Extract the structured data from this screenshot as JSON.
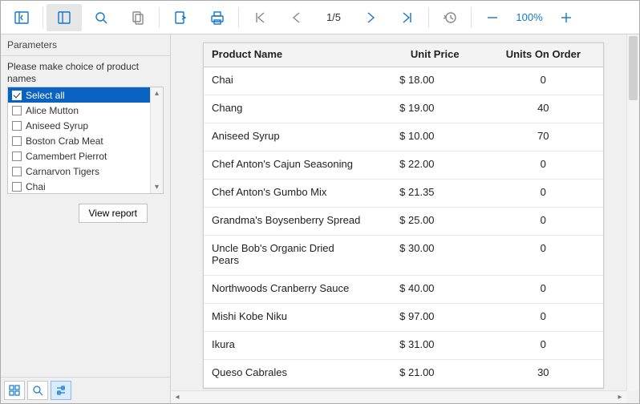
{
  "toolbar": {
    "page_indicator": "1/5",
    "zoom_label": "100%"
  },
  "sidebar": {
    "title": "Parameters",
    "prompt": "Please make choice of product names",
    "items": [
      {
        "label": "Select all",
        "checked": true,
        "selected": true
      },
      {
        "label": "Alice Mutton",
        "checked": false,
        "selected": false
      },
      {
        "label": "Aniseed Syrup",
        "checked": false,
        "selected": false
      },
      {
        "label": "Boston Crab Meat",
        "checked": false,
        "selected": false
      },
      {
        "label": "Camembert Pierrot",
        "checked": false,
        "selected": false
      },
      {
        "label": "Carnarvon Tigers",
        "checked": false,
        "selected": false
      },
      {
        "label": "Chai",
        "checked": false,
        "selected": false
      }
    ],
    "view_report_label": "View report"
  },
  "report": {
    "columns": [
      "Product Name",
      "Unit Price",
      "Units On Order"
    ],
    "rows": [
      {
        "name": "Chai",
        "price": "$ 18.00",
        "order": "0"
      },
      {
        "name": "Chang",
        "price": "$ 19.00",
        "order": "40"
      },
      {
        "name": "Aniseed Syrup",
        "price": "$ 10.00",
        "order": "70"
      },
      {
        "name": "Chef Anton's Cajun Seasoning",
        "price": "$ 22.00",
        "order": "0"
      },
      {
        "name": "Chef Anton's Gumbo Mix",
        "price": "$ 21.35",
        "order": "0"
      },
      {
        "name": "Grandma's Boysenberry Spread",
        "price": "$ 25.00",
        "order": "0"
      },
      {
        "name": "Uncle Bob's Organic Dried Pears",
        "price": "$ 30.00",
        "order": "0"
      },
      {
        "name": "Northwoods Cranberry Sauce",
        "price": "$ 40.00",
        "order": "0"
      },
      {
        "name": "Mishi Kobe Niku",
        "price": "$ 97.00",
        "order": "0"
      },
      {
        "name": "Ikura",
        "price": "$ 31.00",
        "order": "0"
      },
      {
        "name": "Queso Cabrales",
        "price": "$ 21.00",
        "order": "30"
      }
    ]
  }
}
